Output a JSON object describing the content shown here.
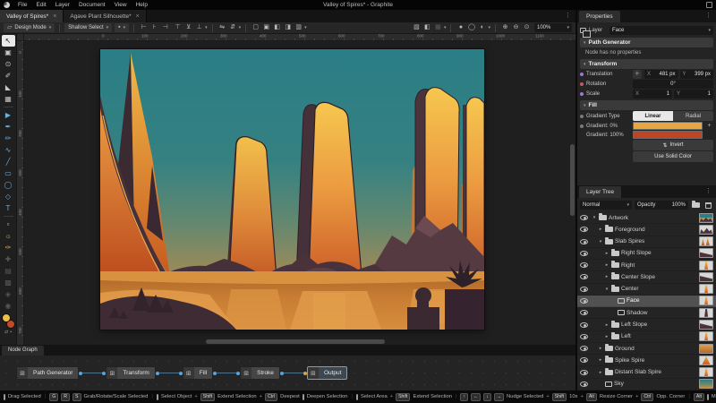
{
  "window": {
    "title": "Valley of Spires* - Graphite",
    "menus": [
      "File",
      "Edit",
      "Layer",
      "Document",
      "View",
      "Help"
    ]
  },
  "icons": {
    "dots": "⋮",
    "chevron": "▾",
    "close": "×",
    "plus": "+",
    "caret_open": "▾",
    "caret_closed": "▸",
    "pivot": "✛",
    "invert": "⇅",
    "design_mode": "▱",
    "select_options": "▪",
    "node_icon": "⊞",
    "swap_colors": "⇄",
    "reset_colors": "▪"
  },
  "document_tabs": [
    {
      "label": "Valley of Spires*",
      "active": true
    },
    {
      "label": "Agave Plant Silhouette*",
      "active": false
    }
  ],
  "options_bar": {
    "design_mode_label": "Design Mode",
    "select_mode_label": "Shallow Select",
    "align_icons": [
      "⊢",
      "⊦",
      "⊣"
    ],
    "distribute_icons": [
      "⊤",
      "⊻",
      "⊥"
    ],
    "flip_icons": [
      "⇋",
      "⇵"
    ],
    "boolean_icons": [
      "▢",
      "▣",
      "◧",
      "◨",
      "▥"
    ],
    "snapping_icons": [
      "▧",
      "◧",
      "▦"
    ],
    "view_mode_icons": [
      "●",
      "◯",
      "◐"
    ],
    "zoom_icons": [
      "⊕",
      "⊖",
      "⊙"
    ],
    "zoom_level": "100%"
  },
  "tools": [
    {
      "name": "select-tool",
      "glyph": "↖",
      "state": "active"
    },
    {
      "name": "artboard-tool",
      "glyph": "▣"
    },
    {
      "name": "navigate-tool",
      "glyph": "⊙"
    },
    {
      "name": "eyedropper-tool",
      "glyph": "✐"
    },
    {
      "name": "fill-tool",
      "glyph": "◣"
    },
    {
      "name": "gradient-tool",
      "glyph": "▦"
    },
    {
      "name": "sep"
    },
    {
      "name": "path-tool",
      "glyph": "▶",
      "tint": "blue"
    },
    {
      "name": "pen-tool",
      "glyph": "✒",
      "tint": "blue"
    },
    {
      "name": "freehand-tool",
      "glyph": "✏",
      "tint": "blue"
    },
    {
      "name": "spline-tool",
      "glyph": "∿",
      "tint": "blue"
    },
    {
      "name": "line-tool",
      "glyph": "╱",
      "tint": "blue"
    },
    {
      "name": "rectangle-tool",
      "glyph": "▭",
      "tint": "blue"
    },
    {
      "name": "ellipse-tool",
      "glyph": "◯",
      "tint": "blue"
    },
    {
      "name": "polygon-tool",
      "glyph": "◇",
      "tint": "blue"
    },
    {
      "name": "text-tool",
      "glyph": "T",
      "tint": "blue"
    },
    {
      "name": "sep"
    },
    {
      "name": "frame-tool",
      "glyph": "▫"
    },
    {
      "name": "imaginate-tool",
      "glyph": "☼",
      "tint": "yellow"
    },
    {
      "name": "brush-tool",
      "glyph": "✑",
      "tint": "yellow"
    },
    {
      "name": "heal-tool",
      "glyph": "✚",
      "state": "disabled"
    },
    {
      "name": "clone-tool",
      "glyph": "▤",
      "state": "disabled"
    },
    {
      "name": "patch-tool",
      "glyph": "▩",
      "state": "disabled"
    },
    {
      "name": "detail-tool",
      "glyph": "◈",
      "state": "disabled"
    },
    {
      "name": "relight-tool",
      "glyph": "◉",
      "state": "disabled"
    }
  ],
  "working_colors": {
    "primary": "#edbf4a",
    "secondary": "#c2492a"
  },
  "rulers": {
    "top": [
      "0",
      "100",
      "200",
      "300",
      "400",
      "500",
      "600",
      "700",
      "800",
      "900",
      "1000",
      "1100",
      "1200"
    ],
    "left": [
      "0",
      "100",
      "200",
      "300",
      "400",
      "500",
      "600",
      "700"
    ]
  },
  "properties_panel": {
    "tab": "Properties",
    "layer_row": {
      "label": "Layer",
      "value": "Face"
    },
    "path_generator": {
      "title": "Path Generator",
      "empty": "Node has no properties"
    },
    "transform": {
      "title": "Transform",
      "translation_label": "Translation",
      "x_label": "X",
      "translation_x": "481 px",
      "y_label": "Y",
      "translation_y": "399 px",
      "rotation_label": "Rotation",
      "rotation_value": "0°",
      "scale_label": "Scale",
      "scale_x": "1",
      "scale_y": "1"
    },
    "fill": {
      "title": "Fill",
      "gradient_type_label": "Gradient Type",
      "linear_label": "Linear",
      "radial_label": "Radial",
      "stop0_label": "Gradient: 0%",
      "stop0_color": "#e8a73e",
      "stop100_label": "Gradient: 100%",
      "stop100_color": "#c04423",
      "invert_label": "Invert",
      "use_solid_label": "Use Solid Color"
    }
  },
  "layer_tree": {
    "tab": "Layer Tree",
    "blend_mode": "Normal",
    "opacity_label": "Opacity",
    "opacity_value": "100%",
    "layers": [
      {
        "label": "Artwork",
        "depth": 0,
        "kind": "folder",
        "expanded": true,
        "thumb": "scene"
      },
      {
        "label": "Foreground",
        "depth": 1,
        "kind": "folder",
        "expanded": false,
        "thumb": "silhouettes"
      },
      {
        "label": "Slab Spires",
        "depth": 1,
        "kind": "folder",
        "expanded": true,
        "thumb": "spires"
      },
      {
        "label": "Right Slope",
        "depth": 2,
        "kind": "folder",
        "expanded": false,
        "thumb": "slope"
      },
      {
        "label": "Right",
        "depth": 2,
        "kind": "folder",
        "expanded": false,
        "thumb": "spire"
      },
      {
        "label": "Center Slope",
        "depth": 2,
        "kind": "folder",
        "expanded": false,
        "thumb": "slope"
      },
      {
        "label": "Center",
        "depth": 2,
        "kind": "folder",
        "expanded": true,
        "thumb": "spire"
      },
      {
        "label": "Face",
        "depth": 3,
        "kind": "layer",
        "selected": true,
        "thumb": "spire"
      },
      {
        "label": "Shadow",
        "depth": 3,
        "kind": "layer",
        "thumb": "spire-dark"
      },
      {
        "label": "Left Slope",
        "depth": 2,
        "kind": "folder",
        "expanded": false,
        "thumb": "slope"
      },
      {
        "label": "Left",
        "depth": 2,
        "kind": "folder",
        "expanded": false,
        "thumb": "spire"
      },
      {
        "label": "Ground",
        "depth": 1,
        "kind": "folder",
        "expanded": false,
        "thumb": "band"
      },
      {
        "label": "Spike Spire",
        "depth": 1,
        "kind": "folder",
        "expanded": false,
        "thumb": "spike"
      },
      {
        "label": "Distant Slab Spire",
        "depth": 1,
        "kind": "folder",
        "expanded": false,
        "thumb": "spire"
      },
      {
        "label": "Sky",
        "depth": 1,
        "kind": "layer",
        "thumb": "sky"
      }
    ]
  },
  "node_graph": {
    "tab": "Node Graph",
    "nodes": [
      "Path Generator",
      "Transform",
      "Fill",
      "Stroke",
      "Output"
    ],
    "accent_node": "Output",
    "wire_color": "#57a5d9",
    "exposed_input_color": "#d9a545"
  },
  "status_bar": {
    "segments": [
      [
        {
          "t": "mouse"
        },
        {
          "t": "text",
          "v": "Drag Selected"
        }
      ],
      [
        {
          "t": "key",
          "v": "G"
        },
        {
          "t": "key",
          "v": "R"
        },
        {
          "t": "key",
          "v": "S"
        },
        {
          "t": "text",
          "v": "Grab/Rotate/Scale Selected"
        }
      ],
      [
        {
          "t": "mouse"
        },
        {
          "t": "text",
          "v": "Select Object"
        },
        {
          "t": "plus"
        },
        {
          "t": "key",
          "v": "Shift"
        },
        {
          "t": "text",
          "v": "Extend Selection"
        },
        {
          "t": "plus"
        },
        {
          "t": "key",
          "v": "Ctrl"
        },
        {
          "t": "text",
          "v": "Deepest"
        },
        {
          "t": "mouse"
        },
        {
          "t": "text",
          "v": "Deepen Selection"
        }
      ],
      [
        {
          "t": "mouse"
        },
        {
          "t": "text",
          "v": "Select Area"
        },
        {
          "t": "plus"
        },
        {
          "t": "key",
          "v": "Shift"
        },
        {
          "t": "text",
          "v": "Extend Selection"
        }
      ],
      [
        {
          "t": "key",
          "v": "↑"
        },
        {
          "t": "key",
          "v": "←"
        },
        {
          "t": "key",
          "v": "↓"
        },
        {
          "t": "key",
          "v": "→"
        },
        {
          "t": "text",
          "v": "Nudge Selected"
        },
        {
          "t": "plus"
        },
        {
          "t": "key",
          "v": "Shift"
        },
        {
          "t": "text",
          "v": "10x"
        },
        {
          "t": "plus"
        },
        {
          "t": "key",
          "v": "Alt"
        },
        {
          "t": "text",
          "v": "Resize Corner"
        },
        {
          "t": "plus"
        },
        {
          "t": "key",
          "v": "Ctrl"
        },
        {
          "t": "text",
          "v": "Opp. Corner"
        }
      ],
      [
        {
          "t": "key",
          "v": "Alt"
        },
        {
          "t": "mouse"
        },
        {
          "t": "text",
          "v": "Move Duplicate"
        }
      ]
    ]
  },
  "colors": {
    "accent_blue": "#57a5d9"
  }
}
